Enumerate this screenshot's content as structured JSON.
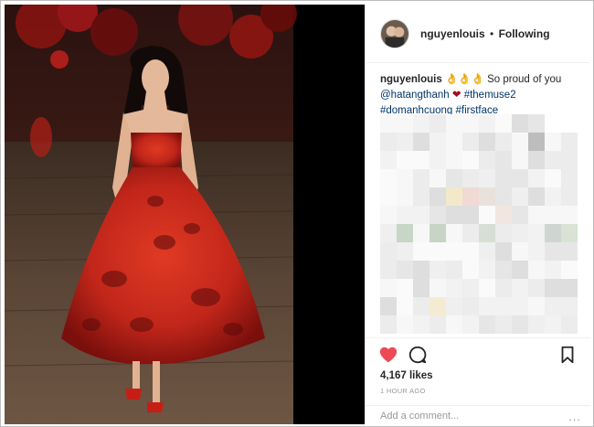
{
  "post": {
    "username": "nguyenlouis",
    "separator": "•",
    "follow_status": "Following",
    "caption": {
      "username": "nguyenlouis",
      "emoji": "👌👌👌",
      "text": "So proud of you",
      "mention": "@hatangthanh",
      "heart": "❤",
      "hashtags": [
        "#themuse2",
        "#domanhcuong",
        "#firstface"
      ]
    },
    "likes": "4,167 likes",
    "timestamp": "1 HOUR AGO",
    "comment_placeholder": "Add a comment...",
    "more_options": "..."
  },
  "icons": {
    "like": "heart-icon",
    "comment": "comment-bubble-icon",
    "save": "bookmark-icon",
    "more": "more-options-icon"
  },
  "colors": {
    "like_active": "#ed4956",
    "hashtag": "#003569",
    "muted": "#999999",
    "dress_red": "#d8281c"
  }
}
